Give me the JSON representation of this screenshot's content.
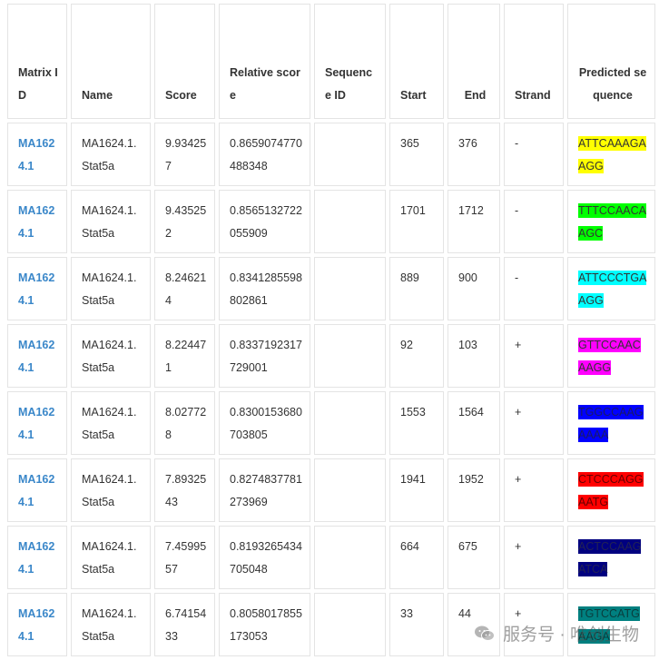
{
  "table": {
    "headers": {
      "matrix_id": "Matrix ID",
      "name": "Name",
      "score": "Score",
      "relative_score": "Relative score",
      "sequence_id": "Sequence ID",
      "start": "Start",
      "end": "End",
      "strand": "Strand",
      "predicted_sequence": "Predicted sequence"
    },
    "rows": [
      {
        "matrix_id": "MA1624.1",
        "name": "MA1624.1.Stat5a",
        "score": "9.934257",
        "relative_score": "0.8659074770488348",
        "sequence_id": "",
        "start": "365",
        "end": "376",
        "strand": "-",
        "sequence": "ATTCAAAGAAGG",
        "seq_bg": "#ffff00",
        "seq_fg": "#333333"
      },
      {
        "matrix_id": "MA1624.1",
        "name": "MA1624.1.Stat5a",
        "score": "9.435252",
        "relative_score": "0.8565132722055909",
        "sequence_id": "",
        "start": "1701",
        "end": "1712",
        "strand": "-",
        "sequence": "TTTCCAACAAGC",
        "seq_bg": "#00ff00",
        "seq_fg": "#333333"
      },
      {
        "matrix_id": "MA1624.1",
        "name": "MA1624.1.Stat5a",
        "score": "8.246214",
        "relative_score": "0.8341285598802861",
        "sequence_id": "",
        "start": "889",
        "end": "900",
        "strand": "-",
        "sequence": "ATTCCCTGAAGG",
        "seq_bg": "#00ffff",
        "seq_fg": "#333333"
      },
      {
        "matrix_id": "MA1624.1",
        "name": "MA1624.1.Stat5a",
        "score": "8.224471",
        "relative_score": "0.8337192317729001",
        "sequence_id": "",
        "start": "92",
        "end": "103",
        "strand": "+",
        "sequence": "GTTCCAACAAGG",
        "seq_bg": "#ff00ff",
        "seq_fg": "#333333"
      },
      {
        "matrix_id": "MA1624.1",
        "name": "MA1624.1.Stat5a",
        "score": "8.027728",
        "relative_score": "0.8300153680703805",
        "sequence_id": "",
        "start": "1553",
        "end": "1564",
        "strand": "+",
        "sequence": "TGGCCAAGAAAA",
        "seq_bg": "#0000ff",
        "seq_fg": "#1a1a66"
      },
      {
        "matrix_id": "MA1624.1",
        "name": "MA1624.1.Stat5a",
        "score": "7.8932543",
        "relative_score": "0.8274837781273969",
        "sequence_id": "",
        "start": "1941",
        "end": "1952",
        "strand": "+",
        "sequence": "CTCCCAGGAATG",
        "seq_bg": "#ff0000",
        "seq_fg": "#660000"
      },
      {
        "matrix_id": "MA1624.1",
        "name": "MA1624.1.Stat5a",
        "score": "7.4599557",
        "relative_score": "0.8193265434705048",
        "sequence_id": "",
        "start": "664",
        "end": "675",
        "strand": "+",
        "sequence": "ACTCCAAGATCA",
        "seq_bg": "#000080",
        "seq_fg": "#222255"
      },
      {
        "matrix_id": "MA1624.1",
        "name": "MA1624.1.Stat5a",
        "score": "6.7415433",
        "relative_score": "0.8058017855173053",
        "sequence_id": "",
        "start": "33",
        "end": "44",
        "strand": "+",
        "sequence": "TGTCCATGAAGA",
        "seq_bg": "#008080",
        "seq_fg": "#0a3d3d"
      }
    ]
  },
  "watermark": {
    "text": "服务号 · 唯创生物",
    "icon": "wechat-icon"
  }
}
